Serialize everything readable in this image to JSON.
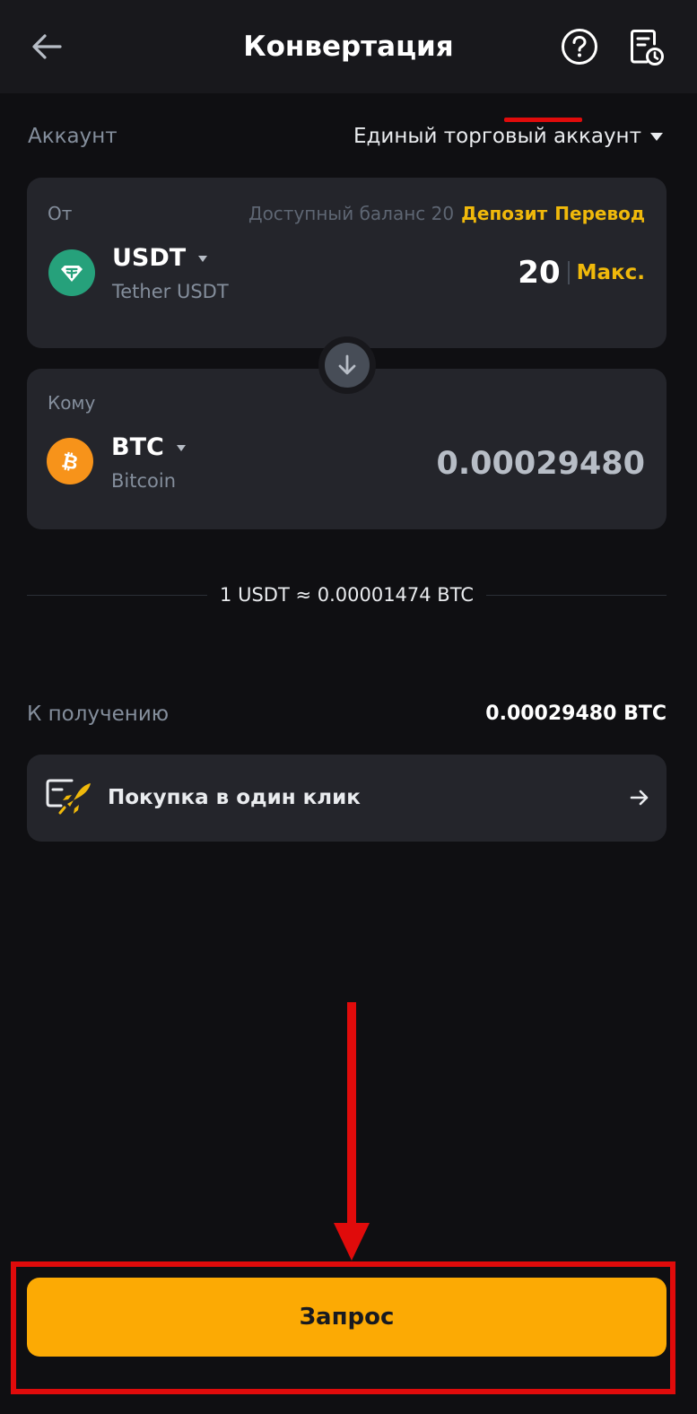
{
  "header": {
    "title": "Конвертация",
    "back_icon": "arrow-left-icon",
    "help_icon": "question-circle-icon",
    "history_icon": "document-clock-icon"
  },
  "account": {
    "label": "Аккаунт",
    "value": "Единый торговый аккаунт"
  },
  "from": {
    "label": "От",
    "available_balance": "Доступный баланс 20",
    "deposit_link": "Депозит",
    "transfer_link": "Перевод",
    "coin_symbol": "USDT",
    "coin_name": "Tether USDT",
    "amount": "20",
    "max_label": "Макс."
  },
  "to": {
    "label": "Кому",
    "coin_symbol": "BTC",
    "coin_name": "Bitcoin",
    "amount": "0.00029480"
  },
  "rate": {
    "text": "1 USDT ≈ 0.00001474 BTC"
  },
  "receive": {
    "label": "К получению",
    "value": "0.00029480 BTC"
  },
  "one_click": {
    "label": "Покупка в один клик"
  },
  "submit": {
    "label": "Запрос"
  },
  "colors": {
    "background": "#0f0f12",
    "card": "#24252b",
    "accent_yellow": "#f0b90b",
    "button_yellow": "#fcaa04",
    "annotation_red": "#e00b0b",
    "usdt_green": "#26a17b",
    "btc_orange": "#f7931a"
  }
}
